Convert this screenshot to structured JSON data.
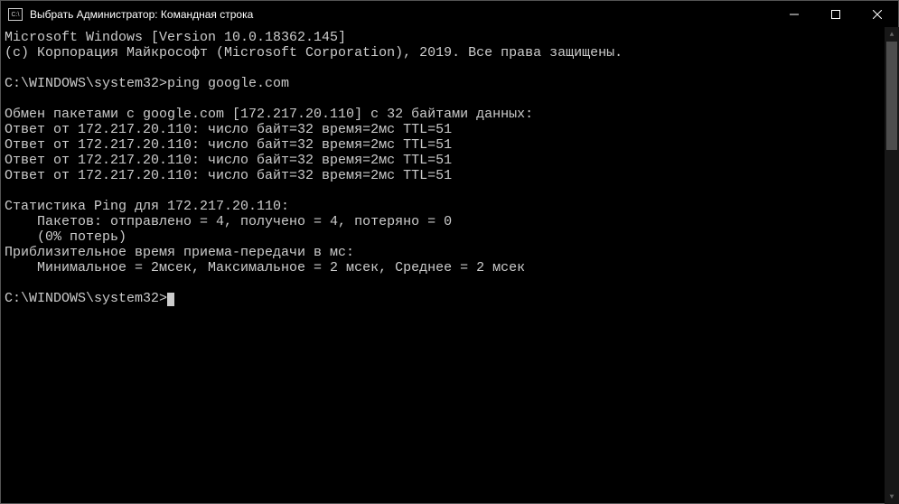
{
  "titlebar": {
    "icon_label": "C:\\",
    "title": "Выбрать Администратор: Командная строка"
  },
  "terminal": {
    "lines": [
      "Microsoft Windows [Version 10.0.18362.145]",
      "(c) Корпорация Майкрософт (Microsoft Corporation), 2019. Все права защищены.",
      "",
      "C:\\WINDOWS\\system32>ping google.com",
      "",
      "Обмен пакетами с google.com [172.217.20.110] с 32 байтами данных:",
      "Ответ от 172.217.20.110: число байт=32 время=2мс TTL=51",
      "Ответ от 172.217.20.110: число байт=32 время=2мс TTL=51",
      "Ответ от 172.217.20.110: число байт=32 время=2мс TTL=51",
      "Ответ от 172.217.20.110: число байт=32 время=2мс TTL=51",
      "",
      "Статистика Ping для 172.217.20.110:",
      "    Пакетов: отправлено = 4, получено = 4, потеряно = 0",
      "    (0% потерь)",
      "Приблизительное время приема-передачи в мс:",
      "    Минимальное = 2мсек, Максимальное = 2 мсек, Среднее = 2 мсек",
      ""
    ],
    "prompt": "C:\\WINDOWS\\system32>"
  }
}
